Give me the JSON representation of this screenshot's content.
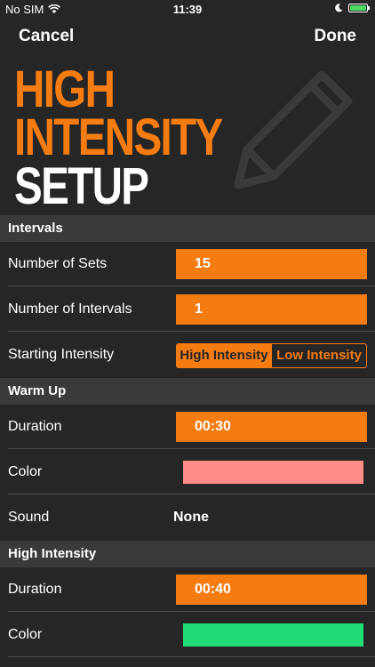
{
  "status_bar": {
    "carrier": "No SIM",
    "time": "11:39"
  },
  "nav": {
    "cancel_label": "Cancel",
    "done_label": "Done"
  },
  "hero": {
    "line1": "HIGH",
    "line2": "INTENSITY",
    "line3": "SETUP",
    "icon": "pencil-icon"
  },
  "sections": {
    "intervals": {
      "title": "Intervals",
      "sets_label": "Number of Sets",
      "sets_value": "15",
      "intervals_label": "Number of Intervals",
      "intervals_value": "1",
      "starting_label": "Starting Intensity",
      "starting_options": [
        "High Intensity",
        "Low Intensity"
      ],
      "starting_selected": "High Intensity"
    },
    "warm_up": {
      "title": "Warm Up",
      "duration_label": "Duration",
      "duration_value": "00:30",
      "color_label": "Color",
      "color_value": "#ff8c87",
      "sound_label": "Sound",
      "sound_value": "None"
    },
    "high_intensity": {
      "title": "High Intensity",
      "duration_label": "Duration",
      "duration_value": "00:40",
      "color_label": "Color",
      "color_value": "#1fdc76"
    }
  },
  "colors": {
    "accent": "#f57c11",
    "background": "#262626",
    "section": "#3a3a3a"
  }
}
